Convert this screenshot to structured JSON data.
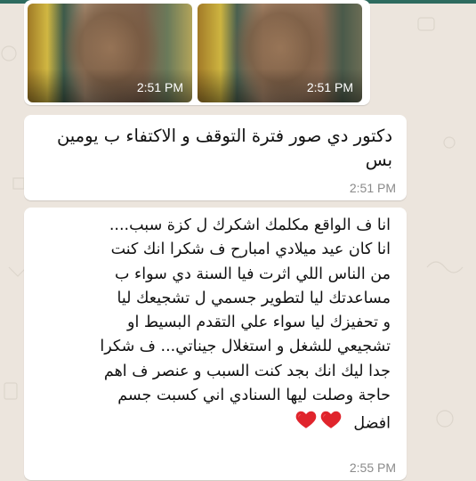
{
  "messages": [
    {
      "type": "photos",
      "photos": [
        {
          "time": "2:51 PM"
        },
        {
          "time": "2:51 PM"
        }
      ]
    },
    {
      "type": "text",
      "text": "دكتور دي صور فترة التوقف و الاكتفاء ب يومين بس",
      "time": "2:51 PM"
    },
    {
      "type": "text",
      "lines": [
        "انا ف الواقع مكلمك اشكرك ل كزة سبب....",
        "انا كان عيد ميلادي امبارح ف شكرا انك كنت",
        "من الناس اللي اثرت فيا السنة دي سواء ب",
        "مساعدتك ليا لتطوير جسمي ل تشجيعك ليا",
        "و تحفيزك ليا سواء علي التقدم البسيط او",
        "تشجيعي للشغل و استغلال جيناتي... ف شكرا",
        "جدا ليك انك بجد كنت السبب و عنصر ف اهم",
        "حاجة  وصلت ليها السنادي اني كسبت جسم",
        "افضل"
      ],
      "emoji": "red-heart-icon x2",
      "time": "2:55 PM"
    }
  ],
  "colors": {
    "chat_background": "#ece5dd",
    "bubble": "#ffffff",
    "heart": "#e0242c",
    "header": "#2e6b5f"
  }
}
